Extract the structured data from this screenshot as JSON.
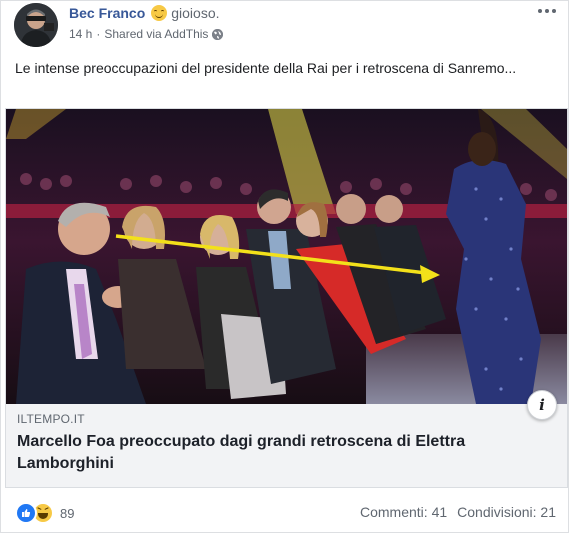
{
  "post": {
    "author_name": "Bec Franco",
    "feeling_icon": "smiling-face-emoji",
    "feeling": "gioioso.",
    "time": "14 h",
    "shared_via": "Shared via AddThis",
    "privacy_icon": "globe-icon",
    "text": "Le intense preoccupazioni del presidente della Rai per i retroscena di Sanremo..."
  },
  "link_preview": {
    "domain": "ILTEMPO.IT",
    "title": "Marcello Foa preoccupato dagi grandi retroscena di Elettra Lamborghini",
    "info_label": "i",
    "arrow_color": "#f3e11a"
  },
  "footer": {
    "reaction_icons": [
      "like-icon",
      "haha-icon"
    ],
    "reaction_count": "89",
    "comments": "Commenti: 41",
    "shares": "Condivisioni: 21"
  },
  "colors": {
    "author": "#385898",
    "like": "#2078f4",
    "haha": "#f7c945"
  }
}
